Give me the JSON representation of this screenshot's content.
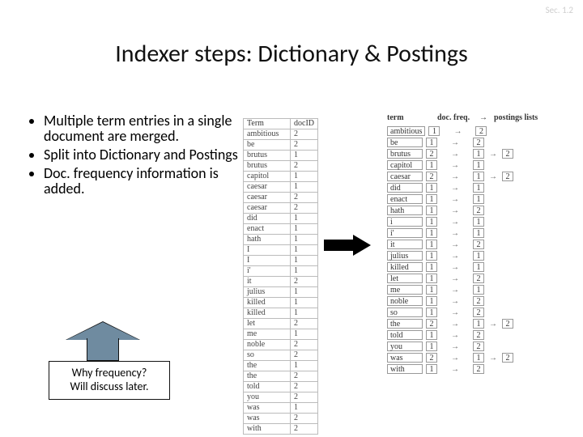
{
  "sec_tag": "Sec. 1.2",
  "title": "Indexer steps: Dictionary & Postings",
  "bullets": [
    "Multiple term entries in a single document are merged.",
    "Split into Dictionary and Postings",
    "Doc. frequency information is added."
  ],
  "callout": {
    "line1": "Why frequency?",
    "line2": "Will discuss later."
  },
  "left_table": {
    "headers": [
      "Term",
      "docID"
    ],
    "rows": [
      [
        "ambitious",
        "2"
      ],
      [
        "be",
        "2"
      ],
      [
        "brutus",
        "1"
      ],
      [
        "brutus",
        "2"
      ],
      [
        "capitol",
        "1"
      ],
      [
        "caesar",
        "1"
      ],
      [
        "caesar",
        "2"
      ],
      [
        "caesar",
        "2"
      ],
      [
        "did",
        "1"
      ],
      [
        "enact",
        "1"
      ],
      [
        "hath",
        "1"
      ],
      [
        "I",
        "1"
      ],
      [
        "I",
        "1"
      ],
      [
        "i'",
        "1"
      ],
      [
        "it",
        "2"
      ],
      [
        "julius",
        "1"
      ],
      [
        "killed",
        "1"
      ],
      [
        "killed",
        "1"
      ],
      [
        "let",
        "2"
      ],
      [
        "me",
        "1"
      ],
      [
        "noble",
        "2"
      ],
      [
        "so",
        "2"
      ],
      [
        "the",
        "1"
      ],
      [
        "the",
        "2"
      ],
      [
        "told",
        "2"
      ],
      [
        "you",
        "2"
      ],
      [
        "was",
        "1"
      ],
      [
        "was",
        "2"
      ],
      [
        "with",
        "2"
      ]
    ]
  },
  "dict": {
    "headers": {
      "term": "term",
      "df": "doc. freq.",
      "arrow": "→",
      "pl": "postings lists"
    },
    "rows": [
      {
        "term": "ambitious",
        "df": "1",
        "postings": [
          "2"
        ]
      },
      {
        "term": "be",
        "df": "1",
        "postings": [
          "2"
        ]
      },
      {
        "term": "brutus",
        "df": "2",
        "postings": [
          "1",
          "2"
        ]
      },
      {
        "term": "capitol",
        "df": "1",
        "postings": [
          "1"
        ]
      },
      {
        "term": "caesar",
        "df": "2",
        "postings": [
          "1",
          "2"
        ]
      },
      {
        "term": "did",
        "df": "1",
        "postings": [
          "1"
        ]
      },
      {
        "term": "enact",
        "df": "1",
        "postings": [
          "1"
        ]
      },
      {
        "term": "hath",
        "df": "1",
        "postings": [
          "2"
        ]
      },
      {
        "term": "i",
        "df": "1",
        "postings": [
          "1"
        ]
      },
      {
        "term": "i'",
        "df": "1",
        "postings": [
          "1"
        ]
      },
      {
        "term": "it",
        "df": "1",
        "postings": [
          "2"
        ]
      },
      {
        "term": "julius",
        "df": "1",
        "postings": [
          "1"
        ]
      },
      {
        "term": "killed",
        "df": "1",
        "postings": [
          "1"
        ]
      },
      {
        "term": "let",
        "df": "1",
        "postings": [
          "2"
        ]
      },
      {
        "term": "me",
        "df": "1",
        "postings": [
          "1"
        ]
      },
      {
        "term": "noble",
        "df": "1",
        "postings": [
          "2"
        ]
      },
      {
        "term": "so",
        "df": "1",
        "postings": [
          "2"
        ]
      },
      {
        "term": "the",
        "df": "2",
        "postings": [
          "1",
          "2"
        ]
      },
      {
        "term": "told",
        "df": "1",
        "postings": [
          "2"
        ]
      },
      {
        "term": "you",
        "df": "1",
        "postings": [
          "2"
        ]
      },
      {
        "term": "was",
        "df": "2",
        "postings": [
          "1",
          "2"
        ]
      },
      {
        "term": "with",
        "df": "1",
        "postings": [
          "2"
        ]
      }
    ]
  }
}
